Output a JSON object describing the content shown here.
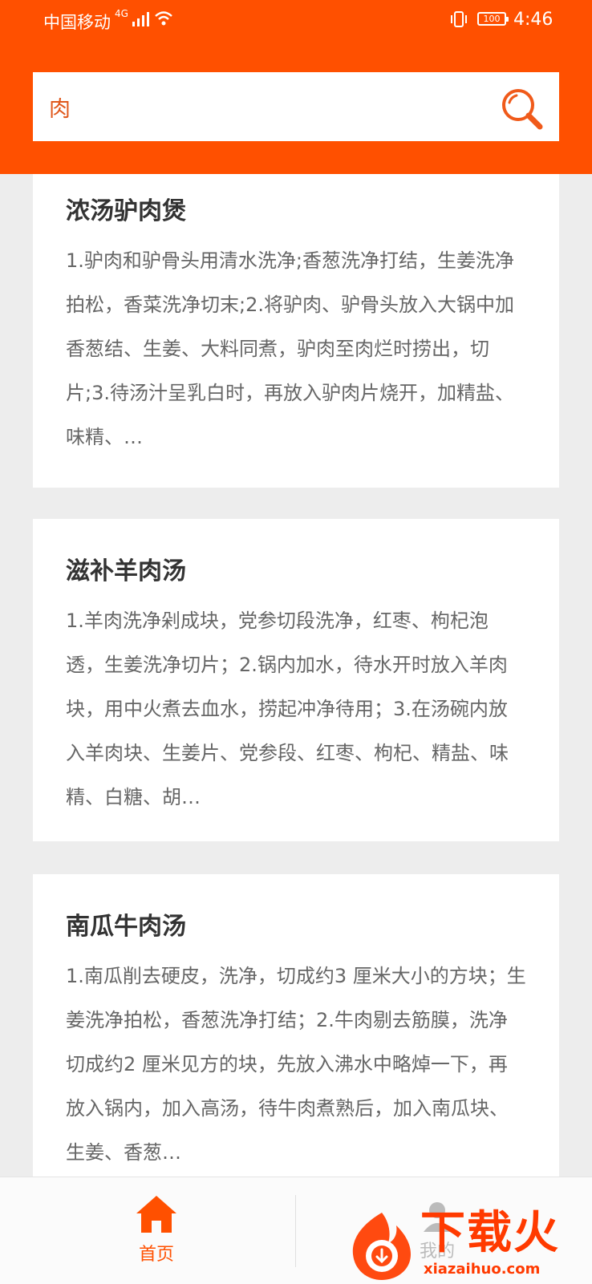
{
  "status_bar": {
    "carrier": "中国移动",
    "network": "4G",
    "battery": "100",
    "time": "4:46"
  },
  "search": {
    "value": "肉",
    "accent": "#ff5000"
  },
  "recipes": [
    {
      "title": "浓汤驴肉煲",
      "desc": "1.驴肉和驴骨头用清水洗净;香葱洗净打结，生姜洗净拍松，香菜洗净切末;2.将驴肉、驴骨头放入大锅中加香葱结、生姜、大料同煮，驴肉至肉烂时捞出，切片;3.待汤汁呈乳白时，再放入驴肉片烧开，加精盐、味精、…"
    },
    {
      "title": "滋补羊肉汤",
      "desc": "1.羊肉洗净剁成块，党参切段洗净，红枣、枸杞泡透，生姜洗净切片；2.锅内加水，待水开时放入羊肉块，用中火煮去血水，捞起冲净待用；3.在汤碗内放入羊肉块、生姜片、党参段、红枣、枸杞、精盐、味精、白糖、胡…"
    },
    {
      "title": "南瓜牛肉汤",
      "desc": "1.南瓜削去硬皮，洗净，切成约3 厘米大小的方块；生姜洗净拍松，香葱洗净打结；2.牛肉剔去筋膜，洗净切成约2 厘米见方的块，先放入沸水中略焯一下，再放入锅内，加入高汤，待牛肉煮熟后，加入南瓜块、生姜、香葱…"
    }
  ],
  "tabbar": {
    "home_label": "首页",
    "mine_label": "我的"
  },
  "watermark": {
    "title": "下载火",
    "url": "xiazaihuo.com"
  }
}
